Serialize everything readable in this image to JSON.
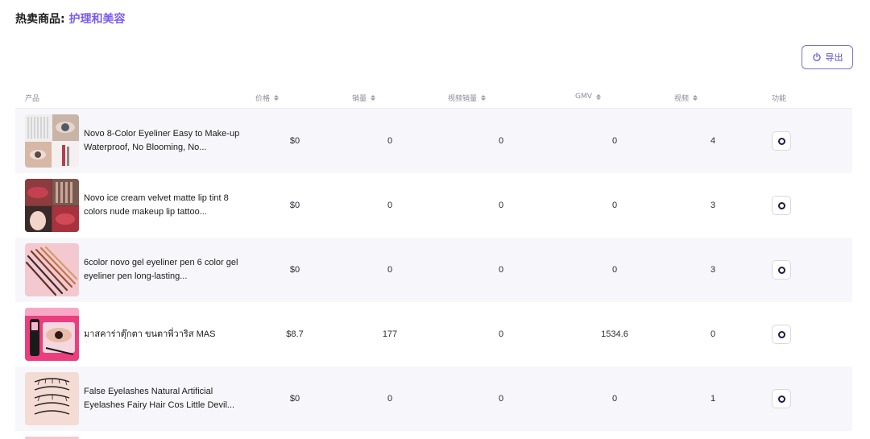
{
  "header": {
    "prefix": "热卖商品:",
    "category": "护理和美容"
  },
  "toolbar": {
    "export_label": "导出",
    "export_icon": "power-icon"
  },
  "table": {
    "columns": [
      "产品",
      "价格",
      "销量",
      "视频销量",
      "GMV",
      "视频",
      "功能"
    ],
    "rows": [
      {
        "name": "Novo 8-Color Eyeliner Easy to Make-up Waterproof, No Blooming, No...",
        "price": "$0",
        "sales": "0",
        "video_sales": "0",
        "gmv": "0",
        "videos": "4"
      },
      {
        "name": "Novo ice cream velvet matte lip tint 8 colors nude makeup lip tattoo...",
        "price": "$0",
        "sales": "0",
        "video_sales": "0",
        "gmv": "0",
        "videos": "3"
      },
      {
        "name": "6color novo gel eyeliner pen 6 color gel eyeliner pen long-lasting...",
        "price": "$0",
        "sales": "0",
        "video_sales": "0",
        "gmv": "0",
        "videos": "3"
      },
      {
        "name": "มาสคาร่าตุ๊กตา ขนตาพี่วาริส MAS",
        "price": "$8.7",
        "sales": "177",
        "video_sales": "0",
        "gmv": "1534.6",
        "videos": "0"
      },
      {
        "name": "False Eyelashes Natural Artificial Eyelashes Fairy Hair Cos Little Devil...",
        "price": "$0",
        "sales": "0",
        "video_sales": "0",
        "gmv": "0",
        "videos": "1"
      }
    ]
  },
  "colors": {
    "accent": "#7b5cf0",
    "row_alt": "#f7f7fb",
    "button_border": "#7b6fd8"
  }
}
